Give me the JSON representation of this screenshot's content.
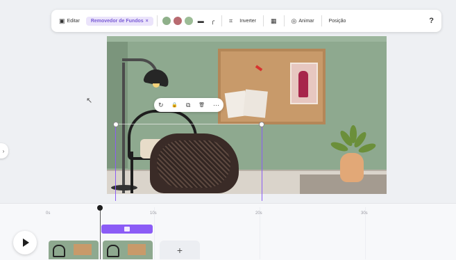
{
  "toolbar": {
    "edit_label": "Editar",
    "bg_remover_label": "Removedor de Fundos",
    "bg_remover_close": "×",
    "colors": [
      "#8fb08a",
      "#b86a70",
      "#9cbc96"
    ],
    "flip_label": "Inverter",
    "animate_label": "Animar",
    "position_label": "Posição",
    "paint_icon": "paint-roller-icon",
    "help_icon": "?"
  },
  "floating_toolbar": {
    "icons": [
      "rotate-icon",
      "lock-icon",
      "duplicate-icon",
      "delete-icon",
      "more-icon"
    ],
    "glyphs": [
      "↻",
      "🔒",
      "⧉",
      "🗑",
      "⋯"
    ]
  },
  "timeline": {
    "ruler": [
      "0s",
      "10s",
      "20s",
      "30s"
    ],
    "add_label": "+",
    "play_icon": "play-icon"
  },
  "accent_color": "#8b5cf6"
}
